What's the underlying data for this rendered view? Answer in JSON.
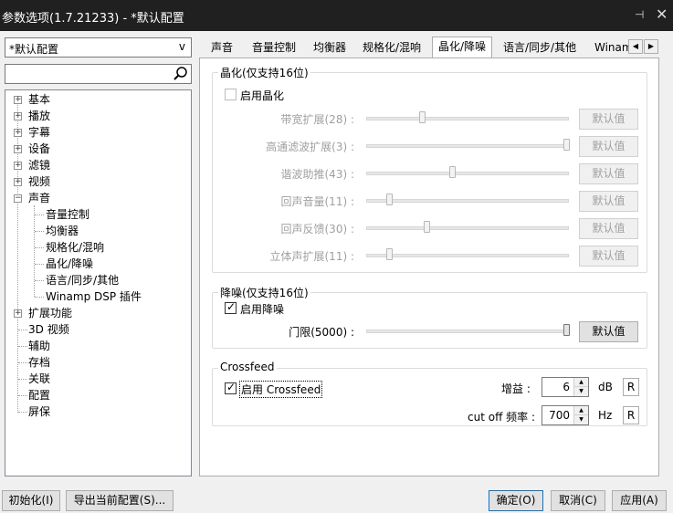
{
  "window": {
    "title": "参数选项(1.7.21233) - *默认配置",
    "pin_icon": "pin-icon",
    "close_icon": "close-icon"
  },
  "profile": {
    "selected": "*默认配置"
  },
  "search": {
    "value": "",
    "icon": "search-icon"
  },
  "tree": {
    "items": [
      {
        "label": "基本"
      },
      {
        "label": "播放"
      },
      {
        "label": "字幕"
      },
      {
        "label": "设备"
      },
      {
        "label": "滤镜"
      },
      {
        "label": "视频"
      },
      {
        "label": "声音"
      },
      {
        "label": "音量控制"
      },
      {
        "label": "均衡器"
      },
      {
        "label": "规格化/混响"
      },
      {
        "label": "晶化/降噪"
      },
      {
        "label": "语言/同步/其他"
      },
      {
        "label": "Winamp DSP 插件"
      },
      {
        "label": "扩展功能"
      },
      {
        "label": "3D 视频"
      },
      {
        "label": "辅助"
      },
      {
        "label": "存档"
      },
      {
        "label": "关联"
      },
      {
        "label": "配置"
      },
      {
        "label": "屏保"
      }
    ]
  },
  "tabs": [
    {
      "label": "声音"
    },
    {
      "label": "音量控制"
    },
    {
      "label": "均衡器"
    },
    {
      "label": "规格化/混响"
    },
    {
      "label": "晶化/降噪"
    },
    {
      "label": "语言/同步/其他"
    },
    {
      "label": "Winam"
    }
  ],
  "crystalize": {
    "title": "晶化(仅支持16位)",
    "enable_label": "启用晶化",
    "enabled": false,
    "sliders": [
      {
        "label": "带宽扩展(28) :",
        "value": 28,
        "button": "默认值"
      },
      {
        "label": "高通滤波扩展(3) :",
        "value": 3,
        "button": "默认值"
      },
      {
        "label": "谐波助推(43) :",
        "value": 43,
        "button": "默认值"
      },
      {
        "label": "回声音量(11) :",
        "value": 11,
        "button": "默认值"
      },
      {
        "label": "回声反馈(30) :",
        "value": 30,
        "button": "默认值"
      },
      {
        "label": "立体声扩展(11) :",
        "value": 11,
        "button": "默认值"
      }
    ]
  },
  "denoise": {
    "title": "降噪(仅支持16位)",
    "enable_label": "启用降噪",
    "enabled": true,
    "threshold_label": "门限(5000) :",
    "threshold_value": 5000,
    "button": "默认值"
  },
  "crossfeed": {
    "title": "Crossfeed",
    "enable_label": "启用 Crossfeed",
    "enabled": true,
    "gain_label": "增益 :",
    "gain_value": "6",
    "gain_unit": "dB",
    "cutoff_label": "cut off 频率 :",
    "cutoff_value": "700",
    "cutoff_unit": "Hz",
    "reset_label": "R"
  },
  "footer": {
    "init": "初始化(I)",
    "export": "导出当前配置(S)...",
    "ok": "确定(O)",
    "cancel": "取消(C)",
    "apply": "应用(A)"
  }
}
